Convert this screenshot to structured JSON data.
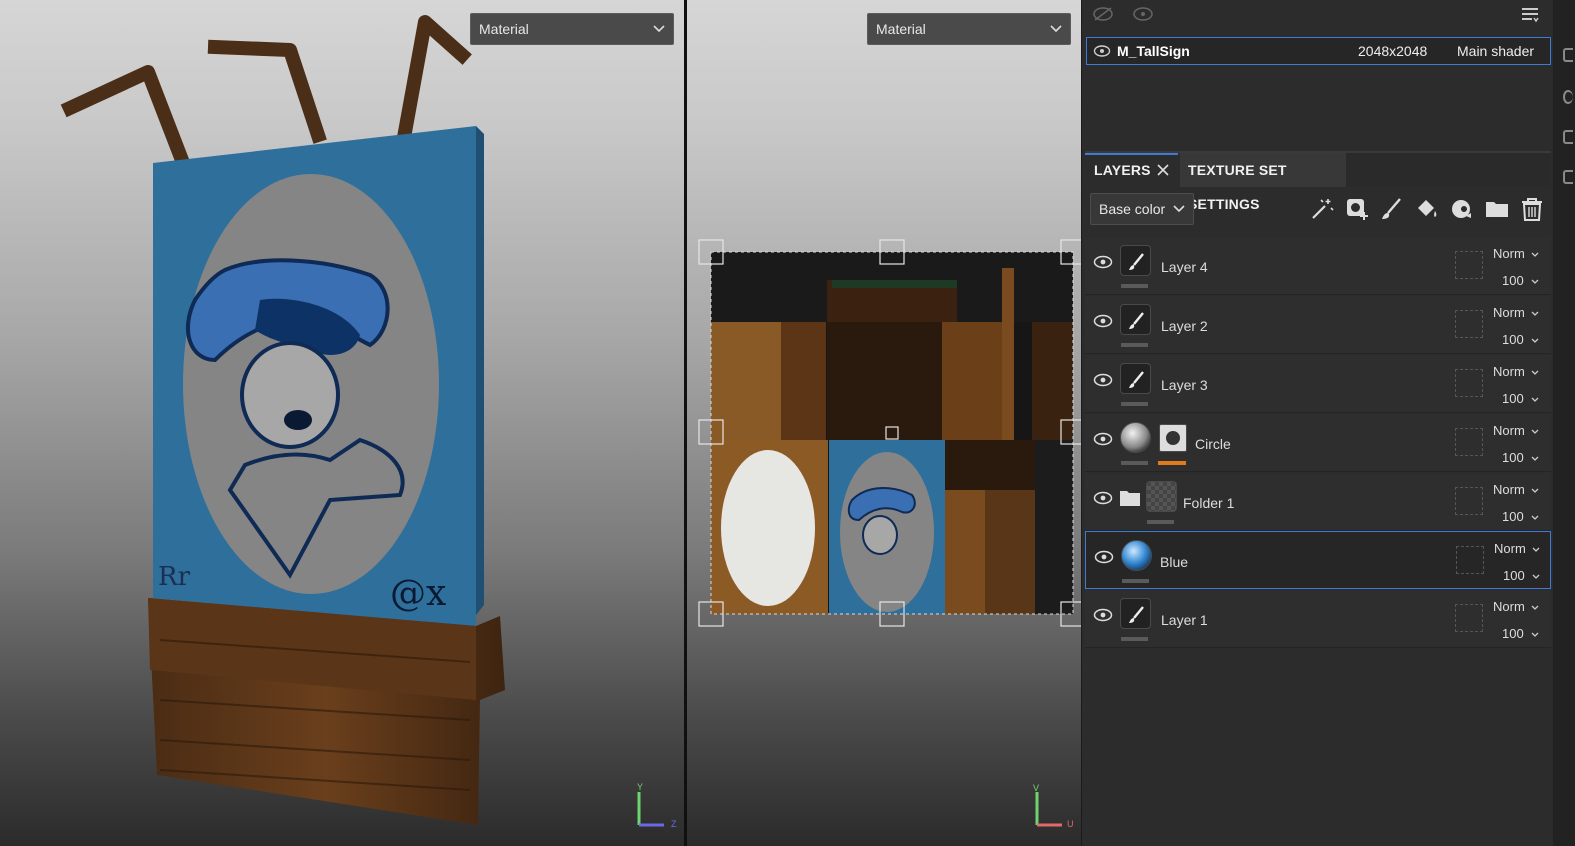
{
  "viewports": {
    "left": {
      "mode": "Material",
      "axes": [
        "Y",
        "Z"
      ]
    },
    "right": {
      "mode": "Material",
      "axes": [
        "V",
        "U"
      ]
    }
  },
  "texture_set": {
    "name": "M_TallSign",
    "resolution": "2048x2048",
    "shader": "Main shader"
  },
  "tabs": {
    "layers": "LAYERS",
    "texture_set_settings": "TEXTURE SET SETTINGS"
  },
  "channel": "Base color",
  "tools": [
    "magic-wand-icon",
    "add-mask-icon",
    "paint-layer-icon",
    "fill-layer-icon",
    "smart-material-icon",
    "folder-icon",
    "delete-icon"
  ],
  "layers": [
    {
      "name": "Layer 4",
      "kind": "paint",
      "blend": "Norm",
      "opacity": "100"
    },
    {
      "name": "Layer 2",
      "kind": "paint",
      "blend": "Norm",
      "opacity": "100"
    },
    {
      "name": "Layer 3",
      "kind": "paint",
      "blend": "Norm",
      "opacity": "100"
    },
    {
      "name": "Circle",
      "kind": "fill-mask",
      "blend": "Norm",
      "opacity": "100"
    },
    {
      "name": "Folder 1",
      "kind": "folder",
      "blend": "Norm",
      "opacity": "100"
    },
    {
      "name": "Blue",
      "kind": "fill",
      "blend": "Norm",
      "opacity": "100",
      "selected": true
    },
    {
      "name": "Layer 1",
      "kind": "paint",
      "blend": "Norm",
      "opacity": "100"
    }
  ],
  "colors": {
    "accent": "#3d7bd4",
    "panel": "#2c2c2c",
    "sign_blue": "#2f6f9c",
    "mask_orange": "#e07a1f"
  }
}
